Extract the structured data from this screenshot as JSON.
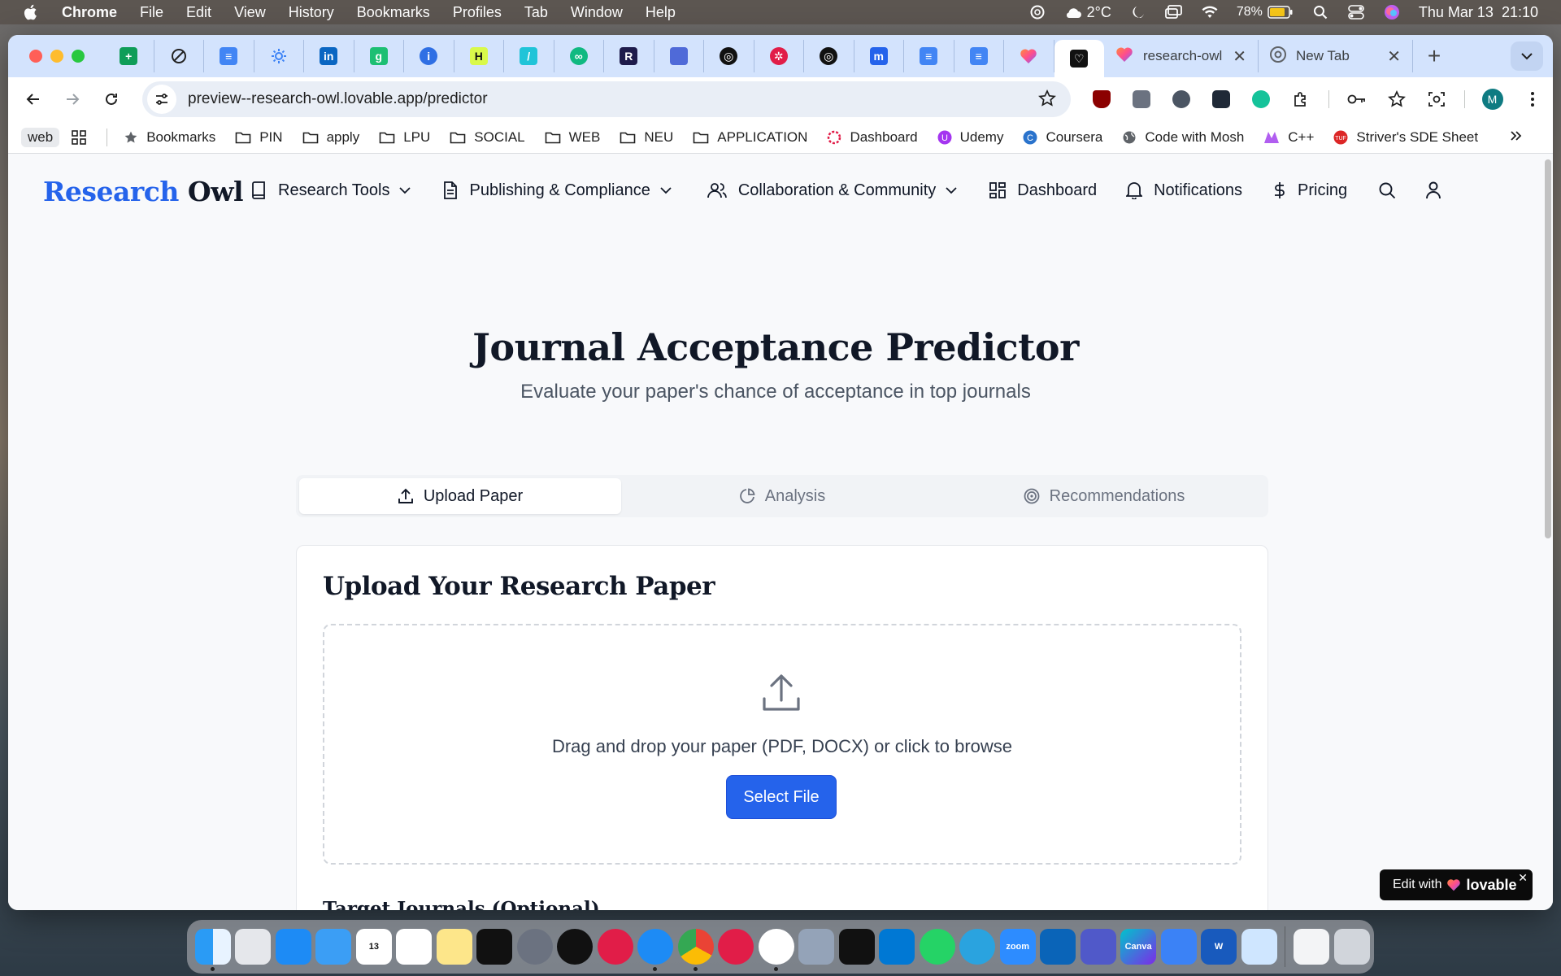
{
  "menubar": {
    "app": "Chrome",
    "items": [
      "File",
      "Edit",
      "View",
      "History",
      "Bookmarks",
      "Profiles",
      "Tab",
      "Window",
      "Help"
    ],
    "weather": "2°C",
    "battery": "78%",
    "datetime": "Thu Mar 13  21:10"
  },
  "browser": {
    "tabs": [
      {
        "title": "research-owl",
        "icon": "lovable-heart-icon"
      },
      {
        "title": "New Tab",
        "icon": "chrome-icon"
      }
    ],
    "url_host": "preview--research-owl.lovable.app",
    "url_path": "/predictor",
    "avatar_letter": "M"
  },
  "bookmarks": {
    "web_label": "web",
    "items": [
      {
        "label": "Bookmarks",
        "icon": "star-icon"
      },
      {
        "label": "PIN",
        "icon": "folder-icon"
      },
      {
        "label": "apply",
        "icon": "folder-icon"
      },
      {
        "label": "LPU",
        "icon": "folder-icon"
      },
      {
        "label": "SOCIAL",
        "icon": "folder-icon"
      },
      {
        "label": "WEB",
        "icon": "folder-icon"
      },
      {
        "label": "NEU",
        "icon": "folder-icon"
      },
      {
        "label": "APPLICATION",
        "icon": "folder-icon"
      },
      {
        "label": "Dashboard",
        "icon": "dashboard-icon"
      },
      {
        "label": "Udemy",
        "icon": "udemy-icon"
      },
      {
        "label": "Coursera",
        "icon": "coursera-icon"
      },
      {
        "label": "Code with Mosh",
        "icon": "globe-icon"
      },
      {
        "label": "C++",
        "icon": "cpp-icon"
      },
      {
        "label": "Striver's SDE Sheet",
        "icon": "tuf-icon"
      }
    ]
  },
  "site": {
    "logo_part1": "Research",
    "logo_part2": "Owl",
    "nav": {
      "research_tools": "Research Tools",
      "publishing": "Publishing & Compliance",
      "collaboration": "Collaboration & Community",
      "dashboard": "Dashboard",
      "notifications": "Notifications",
      "pricing": "Pricing"
    },
    "title": "Journal Acceptance Predictor",
    "subtitle": "Evaluate your paper's chance of acceptance in top journals",
    "tabs": {
      "upload": "Upload Paper",
      "analysis": "Analysis",
      "recommendations": "Recommendations"
    },
    "card": {
      "title": "Upload Your Research Paper",
      "drop_text": "Drag and drop your paper (PDF, DOCX) or click to browse",
      "select_button": "Select File",
      "target_label": "Target Journals (Optional)"
    },
    "badge": {
      "prefix": "Edit with",
      "brand": "lovable"
    }
  },
  "colors": {
    "accent": "#2563eb",
    "tabstrip": "#d3e3fd"
  }
}
